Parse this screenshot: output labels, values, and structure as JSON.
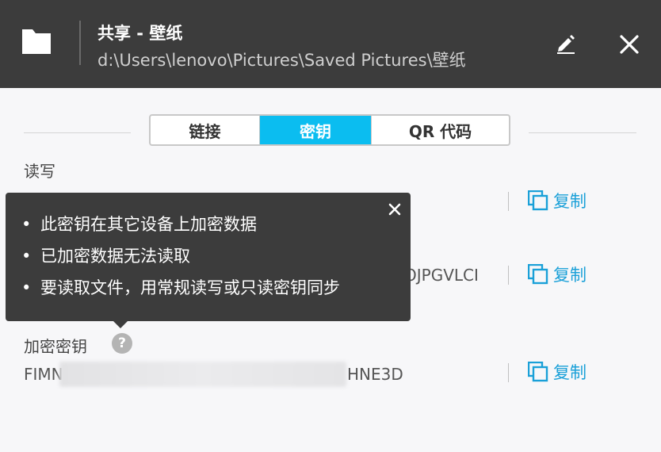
{
  "header": {
    "title": "共享 - 壁纸",
    "path": "d:\\Users\\lenovo\\Pictures\\Saved Pictures\\壁纸",
    "icons": [
      "folder-icon",
      "pencil-icon",
      "close-icon"
    ]
  },
  "tabs": [
    {
      "label": "链接",
      "selected": false
    },
    {
      "label": "密钥",
      "selected": true
    },
    {
      "label": "QR 代码",
      "selected": false
    }
  ],
  "sections": {
    "read_write": {
      "label": "读写"
    },
    "read_only": {
      "key_suffix": "OJPGVLCI"
    },
    "encrypted": {
      "label": "加密密钥",
      "key_prefix": "FIMN",
      "key_suffix": "HNE3D",
      "help": "?"
    }
  },
  "copy_label": "复制",
  "tooltip": {
    "items": [
      "此密钥在其它设备上加密数据",
      "已加密数据无法读取",
      "要读取文件，用常规读写或只读密钥同步"
    ]
  },
  "colors": {
    "header_bg": "#3c3c3c",
    "accent": "#0bbdf0",
    "link": "#1aa0d8"
  }
}
